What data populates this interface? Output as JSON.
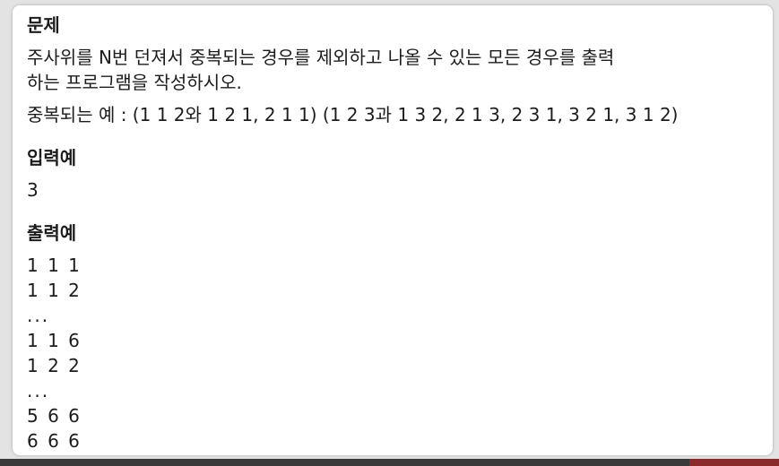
{
  "problem": {
    "heading": "문제",
    "line1": "주사위를 N번 던져서 중복되는 경우를 제외하고 나올 수 있는 모든 경우를 출력",
    "line2": "하는 프로그램을 작성하시오.",
    "line3": "중복되는 예 : (1 1 2와 1 2 1, 2 1 1) (1 2 3과 1 3 2, 2 1 3, 2 3 1, 3 2 1, 3 1 2)"
  },
  "input_example": {
    "heading": "입력예",
    "value": "3"
  },
  "output_example": {
    "heading": "출력예",
    "lines": [
      "1 1 1",
      "1 1 2",
      "...",
      "1 1 6",
      "1 2 2",
      "...",
      "5 6 6",
      "6 6 6"
    ]
  }
}
